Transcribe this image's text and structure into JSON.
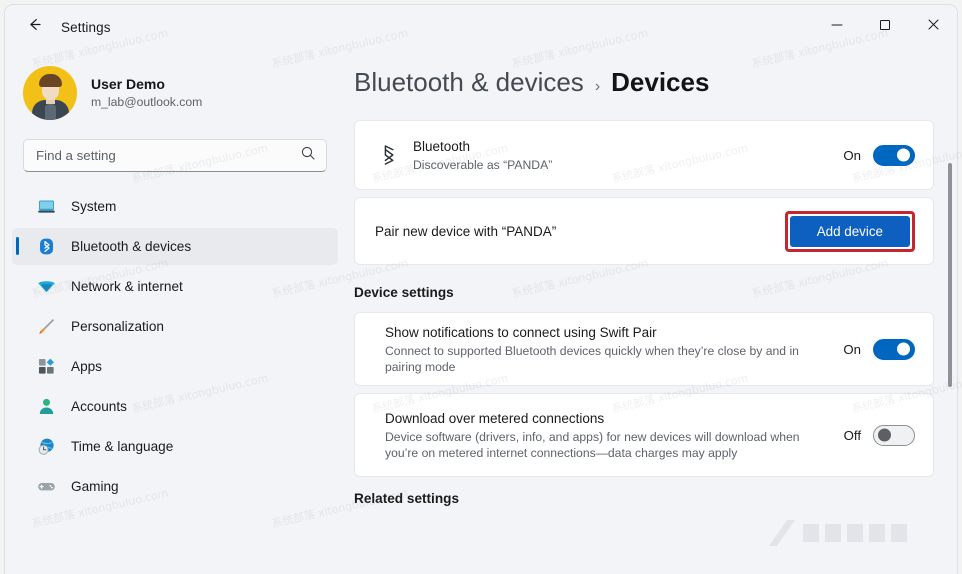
{
  "window": {
    "app_title": "Settings",
    "back_icon": "arrow-left-icon",
    "minimize_label": "Minimize",
    "maximize_label": "Maximize",
    "close_label": "Close"
  },
  "sidebar": {
    "profile": {
      "name": "User Demo",
      "email": "m_lab@outlook.com",
      "avatar_icon": "user-avatar"
    },
    "search": {
      "placeholder": "Find a setting",
      "value": "",
      "icon": "search-icon"
    },
    "items": [
      {
        "label": "System",
        "icon": "monitor-icon",
        "selected": false
      },
      {
        "label": "Bluetooth & devices",
        "icon": "bluetooth-icon",
        "selected": true
      },
      {
        "label": "Network & internet",
        "icon": "wifi-icon",
        "selected": false
      },
      {
        "label": "Personalization",
        "icon": "paintbrush-icon",
        "selected": false
      },
      {
        "label": "Apps",
        "icon": "apps-grid-icon",
        "selected": false
      },
      {
        "label": "Accounts",
        "icon": "person-icon",
        "selected": false
      },
      {
        "label": "Time & language",
        "icon": "clock-globe-icon",
        "selected": false
      },
      {
        "label": "Gaming",
        "icon": "gamepad-icon",
        "selected": false
      }
    ]
  },
  "main": {
    "breadcrumb": {
      "parent": "Bluetooth & devices",
      "separator": "›",
      "current": "Devices"
    },
    "bluetooth_card": {
      "icon": "bluetooth-icon",
      "title": "Bluetooth",
      "subtitle": "Discoverable as “PANDA”",
      "toggle_label": "On",
      "toggle_state": "on"
    },
    "pair_card": {
      "title": "Pair new device with “PANDA”",
      "button_label": "Add device",
      "highlighted": true
    },
    "device_settings_label": "Device settings",
    "swift_pair_card": {
      "title": "Show notifications to connect using Swift Pair",
      "subtitle": "Connect to supported Bluetooth devices quickly when they’re close by and in pairing mode",
      "toggle_label": "On",
      "toggle_state": "on"
    },
    "metered_card": {
      "title": "Download over metered connections",
      "subtitle": "Device software (drivers, info, and apps) for new devices will download when you’re on metered internet connections—data charges may apply",
      "toggle_label": "Off",
      "toggle_state": "off"
    },
    "partial_section_label": "Related settings"
  },
  "scrollbar": {
    "name": "content-scrollbar"
  },
  "colors": {
    "accent": "#0067c0",
    "button_blue": "#0d5fc0",
    "highlight_red": "#c62430",
    "card_bg": "#ffffff",
    "window_bg": "#f2f4f7",
    "avatar_yellow": "#f3c018"
  },
  "watermarks": [
    "系统部落 xitongbuluo.com",
    "系统部落 xitongbuluo.com",
    "系统部落 xitongbuluo.com",
    "系统部落 xitongbuluo.com",
    "系统部落 xitongbuluo.com",
    "系统部落 xitongbuluo.com",
    "系统部落 xitongbuluo.com",
    "系统部落 xitongbuluo.com",
    "系统部落 xitongbuluo.com",
    "系统部落 xitongbuluo.com",
    "系统部落 xitongbuluo.com",
    "系统部落 xitongbuluo.com",
    "系统部落 xitongbuluo.com",
    "系统部落 xitongbuluo.com",
    "系统部落 xitongbuluo.com",
    "系统部落 xitongbuluo.com",
    "系统部落 xitongbuluo.com",
    "系统部落 xitongbuluo.com"
  ]
}
